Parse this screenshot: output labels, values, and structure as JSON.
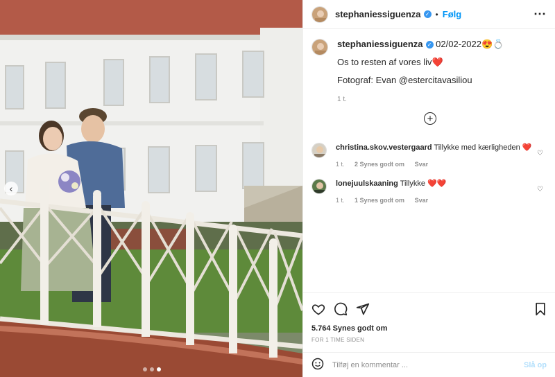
{
  "header": {
    "username": "stephaniessiguenza",
    "separator": "•",
    "follow_label": "Følg",
    "more_label": "⋯"
  },
  "caption": {
    "username": "stephaniessiguenza",
    "date_text": "02/02-2022😍💍",
    "line1": "Os to resten af vores liv❤️",
    "line2": "Fotograf: Evan @estercitavasiliou",
    "time": "1 t."
  },
  "comments": [
    {
      "username": "christina.skov.vestergaard",
      "text": "Tillykke med kærligheden ❤️",
      "time": "1 t.",
      "likes": "2 Synes godt om",
      "reply": "Svar"
    },
    {
      "username": "lonejuulskaaning",
      "text": "Tillykke ❤️❤️",
      "time": "1 t.",
      "likes": "1 Synes godt om",
      "reply": "Svar"
    }
  ],
  "likes_text": "5.764 Synes godt om",
  "time_ago": "FOR 1 TIME SIDEN",
  "add_comment": {
    "placeholder": "Tilføj en kommentar ...",
    "post_label": "Slå op"
  },
  "carousel": {
    "arrow": "‹",
    "slide_count": 3,
    "active_index": 2
  },
  "icons": {
    "verified": "verified-badge-icon",
    "more": "more-options-icon",
    "like": "heart-icon",
    "comment": "comment-bubble-icon",
    "share": "paper-plane-icon",
    "save": "bookmark-icon",
    "emoji": "smiley-icon",
    "load_more": "plus-circle-icon"
  },
  "colors": {
    "accent": "#0095f6",
    "verified": "#3897f0",
    "muted": "#8e8e8e",
    "post_disabled": "#b2dffc",
    "heart": "#ed4956"
  }
}
